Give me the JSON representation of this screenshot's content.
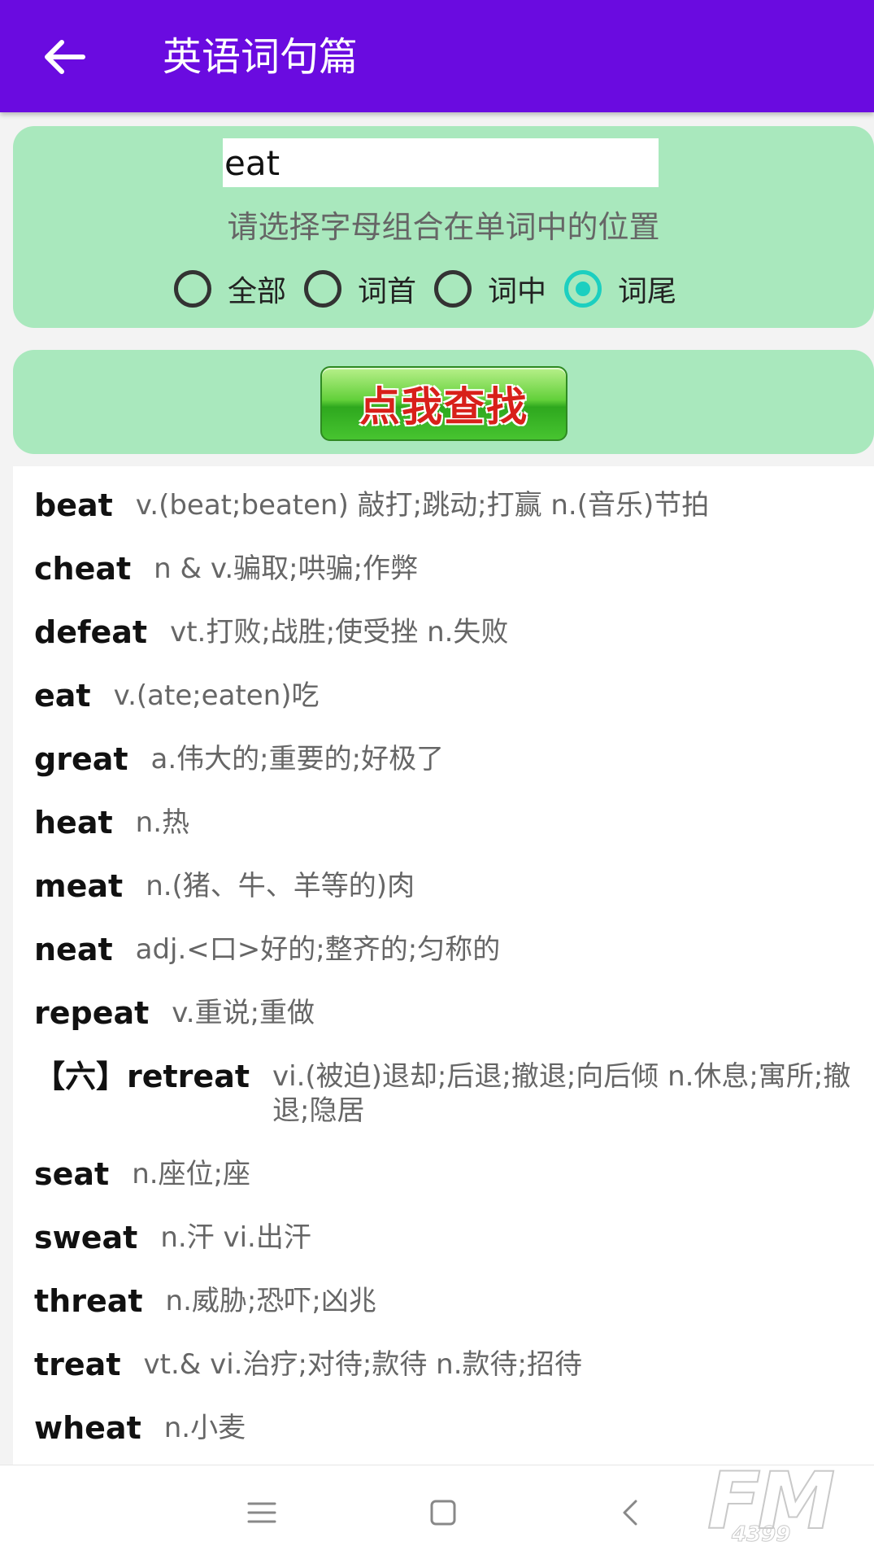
{
  "appbar": {
    "title": "英语词句篇",
    "back_icon": "arrow-left-icon"
  },
  "search": {
    "value": "eat",
    "hint": "请选择字母组合在单词中的位置",
    "options": [
      {
        "label": "全部",
        "checked": false
      },
      {
        "label": "词首",
        "checked": false
      },
      {
        "label": "词中",
        "checked": false
      },
      {
        "label": "词尾",
        "checked": true
      }
    ]
  },
  "find_button": {
    "label": "点我查找"
  },
  "results": [
    {
      "word": "beat",
      "definition": "v.(beat;beaten) 敲打;跳动;打赢 n.(音乐)节拍"
    },
    {
      "word": "cheat",
      "definition": "n & v.骗取;哄骗;作弊"
    },
    {
      "word": "defeat",
      "definition": "vt.打败;战胜;使受挫 n.失败"
    },
    {
      "word": "eat",
      "definition": "v.(ate;eaten)吃"
    },
    {
      "word": "great",
      "definition": "a.伟大的;重要的;好极了"
    },
    {
      "word": "heat",
      "definition": "n.热"
    },
    {
      "word": "meat",
      "definition": "n.(猪、牛、羊等的)肉"
    },
    {
      "word": "neat",
      "definition": "adj.<口>好的;整齐的;匀称的"
    },
    {
      "word": "repeat",
      "definition": "v.重说;重做"
    },
    {
      "word": "【六】retreat",
      "definition": "vi.(被迫)退却;后退;撤退;向后倾 n.休息;寓所;撤退;隐居"
    },
    {
      "word": "seat",
      "definition": "n.座位;座"
    },
    {
      "word": "sweat",
      "definition": "n.汗 vi.出汗"
    },
    {
      "word": "threat",
      "definition": "n.威胁;恐吓;凶兆"
    },
    {
      "word": "treat",
      "definition": "vt.& vi.治疗;对待;款待 n.款待;招待"
    },
    {
      "word": "wheat",
      "definition": "n.小麦"
    }
  ],
  "navbar": {
    "icons": [
      "menu-icon",
      "home-square-icon",
      "back-chevron-icon"
    ]
  },
  "watermark": {
    "big": "FM",
    "small": "4399"
  },
  "colors": {
    "appbar": "#6a0be0",
    "card": "#a9e8bd",
    "radio_checked": "#1ccfc0"
  }
}
